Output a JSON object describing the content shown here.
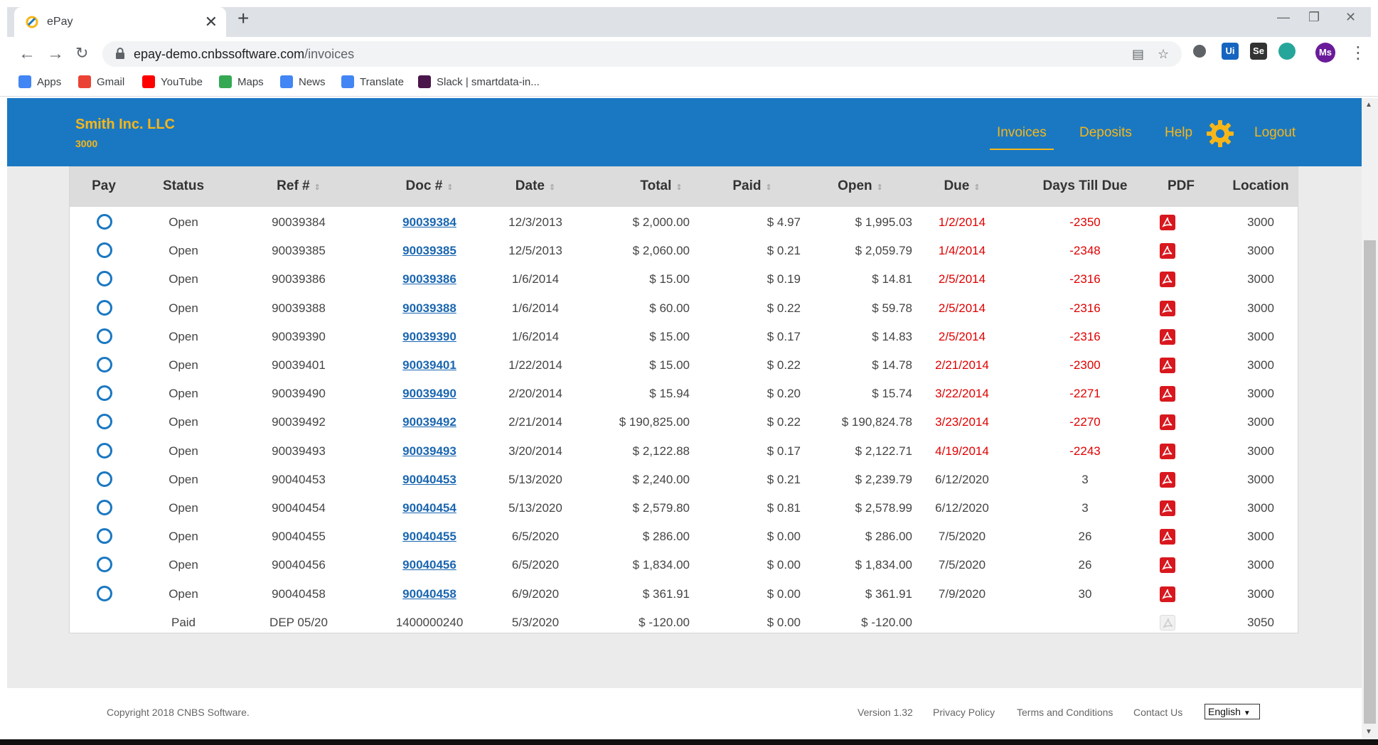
{
  "browser": {
    "tab_title": "ePay",
    "tab_close": "✕",
    "new_tab": "+",
    "url_host": "epay-demo.cnbssoftware.com",
    "url_path": "/invoices",
    "profile_initials": "Ms",
    "bookmarks": [
      {
        "label": "Apps",
        "icon": "apps-grid-icon",
        "color": "#4285f4"
      },
      {
        "label": "Gmail",
        "icon": "gmail-icon",
        "color": "#ea4335"
      },
      {
        "label": "YouTube",
        "icon": "youtube-icon",
        "color": "#ff0000"
      },
      {
        "label": "Maps",
        "icon": "maps-icon",
        "color": "#34a853"
      },
      {
        "label": "News",
        "icon": "news-icon",
        "color": "#4285f4"
      },
      {
        "label": "Translate",
        "icon": "translate-icon",
        "color": "#4285f4"
      },
      {
        "label": "Slack | smartdata-in...",
        "icon": "slack-icon",
        "color": "#4a154b"
      }
    ]
  },
  "header": {
    "company": "Smith Inc. LLC",
    "company_code": "3000",
    "nav": {
      "invoices": "Invoices",
      "deposits": "Deposits",
      "help": "Help",
      "logout": "Logout"
    },
    "colors": {
      "bar": "#1a78c2",
      "accent": "#f7b618"
    }
  },
  "table": {
    "columns": [
      "Pay",
      "Status",
      "Ref #",
      "Doc #",
      "Date",
      "Total",
      "Paid",
      "Open",
      "Due",
      "Days Till Due",
      "PDF",
      "Location"
    ],
    "sortable": [
      "Ref #",
      "Doc #",
      "Date",
      "Total",
      "Paid",
      "Open",
      "Due"
    ],
    "sort_arrow": "⇕",
    "rows": [
      {
        "status": "Open",
        "ref": "90039384",
        "doc": "90039384",
        "date": "12/3/2013",
        "total": "$ 2,000.00",
        "paid": "$ 4.97",
        "open": "$ 1,995.03",
        "due": "1/2/2014",
        "days": "-2350",
        "location": "3000",
        "payable": true,
        "overdue": true,
        "pdf": true
      },
      {
        "status": "Open",
        "ref": "90039385",
        "doc": "90039385",
        "date": "12/5/2013",
        "total": "$ 2,060.00",
        "paid": "$ 0.21",
        "open": "$ 2,059.79",
        "due": "1/4/2014",
        "days": "-2348",
        "location": "3000",
        "payable": true,
        "overdue": true,
        "pdf": true
      },
      {
        "status": "Open",
        "ref": "90039386",
        "doc": "90039386",
        "date": "1/6/2014",
        "total": "$ 15.00",
        "paid": "$ 0.19",
        "open": "$ 14.81",
        "due": "2/5/2014",
        "days": "-2316",
        "location": "3000",
        "payable": true,
        "overdue": true,
        "pdf": true
      },
      {
        "status": "Open",
        "ref": "90039388",
        "doc": "90039388",
        "date": "1/6/2014",
        "total": "$ 60.00",
        "paid": "$ 0.22",
        "open": "$ 59.78",
        "due": "2/5/2014",
        "days": "-2316",
        "location": "3000",
        "payable": true,
        "overdue": true,
        "pdf": true
      },
      {
        "status": "Open",
        "ref": "90039390",
        "doc": "90039390",
        "date": "1/6/2014",
        "total": "$ 15.00",
        "paid": "$ 0.17",
        "open": "$ 14.83",
        "due": "2/5/2014",
        "days": "-2316",
        "location": "3000",
        "payable": true,
        "overdue": true,
        "pdf": true
      },
      {
        "status": "Open",
        "ref": "90039401",
        "doc": "90039401",
        "date": "1/22/2014",
        "total": "$ 15.00",
        "paid": "$ 0.22",
        "open": "$ 14.78",
        "due": "2/21/2014",
        "days": "-2300",
        "location": "3000",
        "payable": true,
        "overdue": true,
        "pdf": true
      },
      {
        "status": "Open",
        "ref": "90039490",
        "doc": "90039490",
        "date": "2/20/2014",
        "total": "$ 15.94",
        "paid": "$ 0.20",
        "open": "$ 15.74",
        "due": "3/22/2014",
        "days": "-2271",
        "location": "3000",
        "payable": true,
        "overdue": true,
        "pdf": true
      },
      {
        "status": "Open",
        "ref": "90039492",
        "doc": "90039492",
        "date": "2/21/2014",
        "total": "$ 190,825.00",
        "paid": "$ 0.22",
        "open": "$ 190,824.78",
        "due": "3/23/2014",
        "days": "-2270",
        "location": "3000",
        "payable": true,
        "overdue": true,
        "pdf": true
      },
      {
        "status": "Open",
        "ref": "90039493",
        "doc": "90039493",
        "date": "3/20/2014",
        "total": "$ 2,122.88",
        "paid": "$ 0.17",
        "open": "$ 2,122.71",
        "due": "4/19/2014",
        "days": "-2243",
        "location": "3000",
        "payable": true,
        "overdue": true,
        "pdf": true
      },
      {
        "status": "Open",
        "ref": "90040453",
        "doc": "90040453",
        "date": "5/13/2020",
        "total": "$ 2,240.00",
        "paid": "$ 0.21",
        "open": "$ 2,239.79",
        "due": "6/12/2020",
        "days": "3",
        "location": "3000",
        "payable": true,
        "overdue": false,
        "pdf": true
      },
      {
        "status": "Open",
        "ref": "90040454",
        "doc": "90040454",
        "date": "5/13/2020",
        "total": "$ 2,579.80",
        "paid": "$ 0.81",
        "open": "$ 2,578.99",
        "due": "6/12/2020",
        "days": "3",
        "location": "3000",
        "payable": true,
        "overdue": false,
        "pdf": true
      },
      {
        "status": "Open",
        "ref": "90040455",
        "doc": "90040455",
        "date": "6/5/2020",
        "total": "$ 286.00",
        "paid": "$ 0.00",
        "open": "$ 286.00",
        "due": "7/5/2020",
        "days": "26",
        "location": "3000",
        "payable": true,
        "overdue": false,
        "pdf": true
      },
      {
        "status": "Open",
        "ref": "90040456",
        "doc": "90040456",
        "date": "6/5/2020",
        "total": "$ 1,834.00",
        "paid": "$ 0.00",
        "open": "$ 1,834.00",
        "due": "7/5/2020",
        "days": "26",
        "location": "3000",
        "payable": true,
        "overdue": false,
        "pdf": true
      },
      {
        "status": "Open",
        "ref": "90040458",
        "doc": "90040458",
        "date": "6/9/2020",
        "total": "$ 361.91",
        "paid": "$ 0.00",
        "open": "$ 361.91",
        "due": "7/9/2020",
        "days": "30",
        "location": "3000",
        "payable": true,
        "overdue": false,
        "pdf": true
      },
      {
        "status": "Paid",
        "ref": "DEP 05/20",
        "doc": "1400000240",
        "date": "5/3/2020",
        "total": "$ -120.00",
        "paid": "$ 0.00",
        "open": "$ -120.00",
        "due": "",
        "days": "",
        "location": "3050",
        "payable": false,
        "overdue": false,
        "pdf": false
      }
    ]
  },
  "footer": {
    "copyright": "Copyright 2018 CNBS Software.",
    "version": "Version 1.32",
    "privacy": "Privacy Policy",
    "terms": "Terms and Conditions",
    "contact": "Contact Us",
    "language": "English"
  }
}
